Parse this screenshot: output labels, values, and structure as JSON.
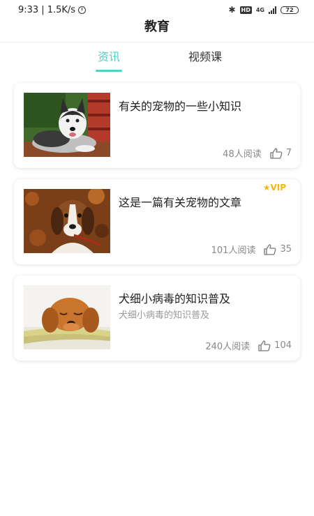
{
  "status_bar": {
    "time": "9:33",
    "speed": "| 1.5K/s",
    "network": "4G",
    "battery": "72"
  },
  "header": {
    "title": "教育"
  },
  "tabs": [
    {
      "label": "资讯",
      "active": true
    },
    {
      "label": "视频课",
      "active": false
    }
  ],
  "colors": {
    "accent": "#4fd1c5",
    "vip": "#f2b90c",
    "meta_text": "#888888"
  },
  "articles": [
    {
      "title": "有关的宠物的一些小知识",
      "subtitle": "",
      "reads": "48人阅读",
      "likes": "7",
      "vip": false,
      "thumbnail": "husky-photo"
    },
    {
      "title": "这是一篇有关宠物的文章",
      "subtitle": "",
      "reads": "101人阅读",
      "likes": "35",
      "vip": true,
      "vip_label": "VIP",
      "thumbnail": "beagle-puppy-photo"
    },
    {
      "title": "犬细小病毒的知识普及",
      "subtitle": "犬细小病毒的知识普及",
      "reads": "240人阅读",
      "likes": "104",
      "vip": false,
      "thumbnail": "golden-retriever-puppy-photo"
    }
  ],
  "icons": {
    "like": "thumbs-up-icon",
    "vip_star": "star-icon"
  }
}
